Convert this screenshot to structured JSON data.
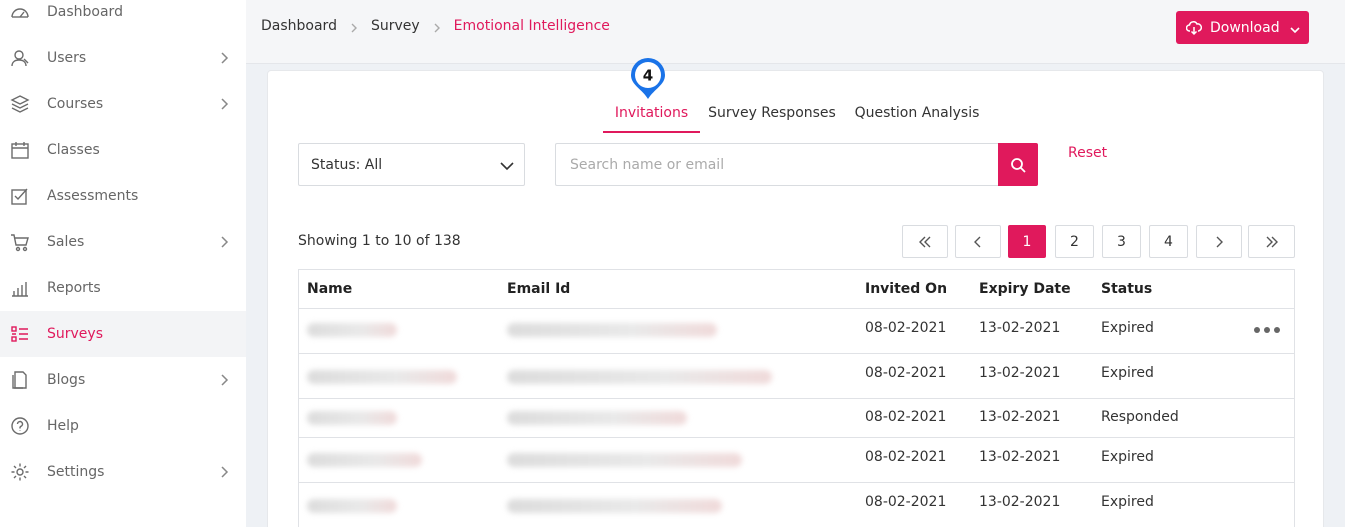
{
  "sidebar": {
    "items": [
      {
        "label": "Dashboard",
        "icon": "dashboard-icon",
        "chevron": false,
        "active": false
      },
      {
        "label": "Users",
        "icon": "users-icon",
        "chevron": true,
        "active": false
      },
      {
        "label": "Courses",
        "icon": "layers-icon",
        "chevron": true,
        "active": false
      },
      {
        "label": "Classes",
        "icon": "calendar-icon",
        "chevron": false,
        "active": false
      },
      {
        "label": "Assessments",
        "icon": "checkbox-icon",
        "chevron": false,
        "active": false
      },
      {
        "label": "Sales",
        "icon": "cart-icon",
        "chevron": true,
        "active": false
      },
      {
        "label": "Reports",
        "icon": "bar-chart-icon",
        "chevron": false,
        "active": false
      },
      {
        "label": "Surveys",
        "icon": "survey-list-icon",
        "chevron": false,
        "active": true
      },
      {
        "label": "Blogs",
        "icon": "blog-icon",
        "chevron": true,
        "active": false
      },
      {
        "label": "Help",
        "icon": "help-icon",
        "chevron": false,
        "active": false
      },
      {
        "label": "Settings",
        "icon": "gear-icon",
        "chevron": true,
        "active": false
      }
    ]
  },
  "header": {
    "breadcrumb": [
      "Dashboard",
      "Survey",
      "Emotional Intelligence"
    ],
    "download_label": "Download"
  },
  "step_marker": "4",
  "tabs": [
    {
      "label": "Invitations",
      "active": true
    },
    {
      "label": "Survey Responses",
      "active": false
    },
    {
      "label": "Question Analysis",
      "active": false
    }
  ],
  "filters": {
    "status_label": "Status: All",
    "search_placeholder": "Search name or email",
    "reset_label": "Reset"
  },
  "pagination": {
    "showing": "Showing 1 to 10 of 138",
    "pages": [
      "1",
      "2",
      "3",
      "4"
    ],
    "current": "1"
  },
  "table": {
    "columns": [
      "Name",
      "Email Id",
      "Invited On",
      "Expiry Date",
      "Status"
    ],
    "rows": [
      {
        "invited_on": "08-02-2021",
        "expiry_date": "13-02-2021",
        "status": "Expired"
      },
      {
        "invited_on": "08-02-2021",
        "expiry_date": "13-02-2021",
        "status": "Expired"
      },
      {
        "invited_on": "08-02-2021",
        "expiry_date": "13-02-2021",
        "status": "Responded"
      },
      {
        "invited_on": "08-02-2021",
        "expiry_date": "13-02-2021",
        "status": "Expired"
      },
      {
        "invited_on": "08-02-2021",
        "expiry_date": "13-02-2021",
        "status": "Expired"
      }
    ]
  },
  "colors": {
    "accent": "#e0195c",
    "marker": "#1a73e8"
  }
}
